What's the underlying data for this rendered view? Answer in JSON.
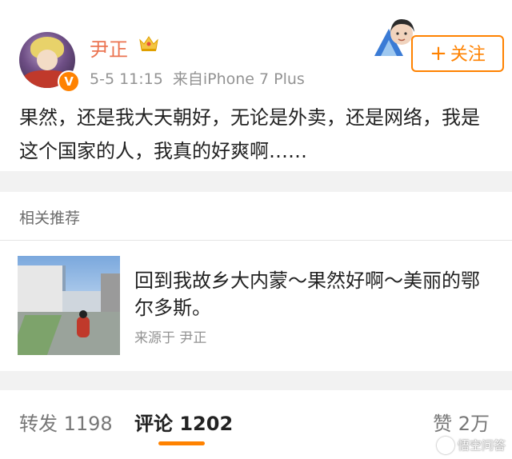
{
  "post": {
    "username": "尹正",
    "time": "5-5 11:15",
    "source": "来自iPhone 7 Plus",
    "follow_label": "关注",
    "follow_plus": "+",
    "verified_badge": "V",
    "content": "果然，还是我大天朝好，无论是外卖，还是网络，我是这个国家的人，我真的好爽啊……"
  },
  "related": {
    "section_title": "相关推荐",
    "item": {
      "title": "回到我故乡大内蒙～果然好啊～美丽的鄂尔多斯。",
      "source": "来源于 尹正"
    }
  },
  "actions": {
    "repost": "转发 1198",
    "comment": "评论 1202",
    "like": "赞 2万"
  },
  "watermark": "悟空问答",
  "colors": {
    "accent": "#ff8200",
    "username": "#eb7350",
    "meta": "#939393"
  },
  "icons": [
    "avatar",
    "verified-badge-icon",
    "crown-icon",
    "sticker-avatar-icon",
    "plus-icon",
    "thumbnail-image"
  ]
}
